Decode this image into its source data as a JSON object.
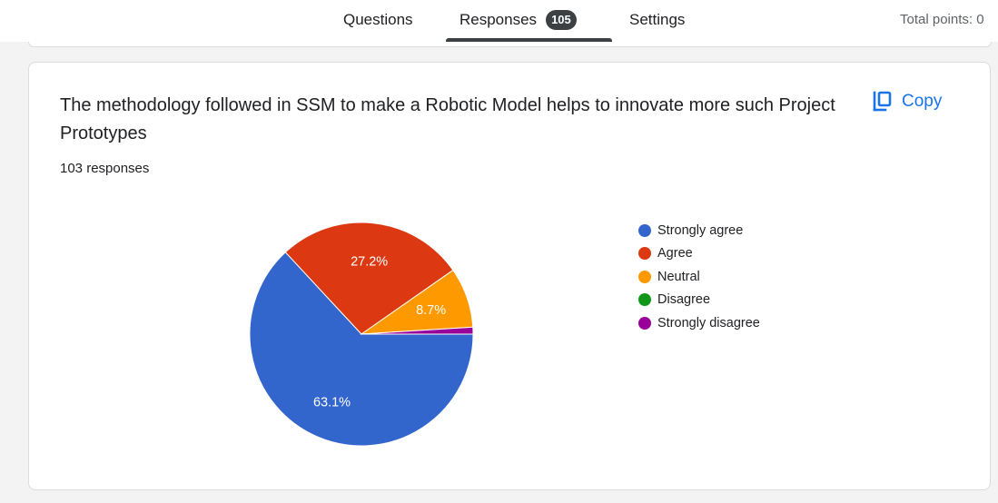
{
  "tabs": {
    "questions": "Questions",
    "responses": "Responses",
    "responses_badge": "105",
    "settings": "Settings"
  },
  "total_points": "Total points: 0",
  "question": {
    "title": "The methodology followed in SSM  to make a Robotic Model helps to innovate more such Project Prototypes",
    "response_count": "103 responses",
    "copy_label": "Copy"
  },
  "chart_data": {
    "type": "pie",
    "total": 103,
    "slices": [
      {
        "name": "Strongly agree",
        "value": 63.1,
        "label": "63.1%",
        "color": "#3366cc"
      },
      {
        "name": "Agree",
        "value": 27.2,
        "label": "27.2%",
        "color": "#dc3912"
      },
      {
        "name": "Neutral",
        "value": 8.7,
        "label": "8.7%",
        "color": "#ff9900"
      },
      {
        "name": "Disagree",
        "value": 0,
        "label": "",
        "color": "#109618"
      },
      {
        "name": "Strongly disagree",
        "value": 1.0,
        "label": "",
        "color": "#990099"
      }
    ],
    "legend_position": "right"
  }
}
